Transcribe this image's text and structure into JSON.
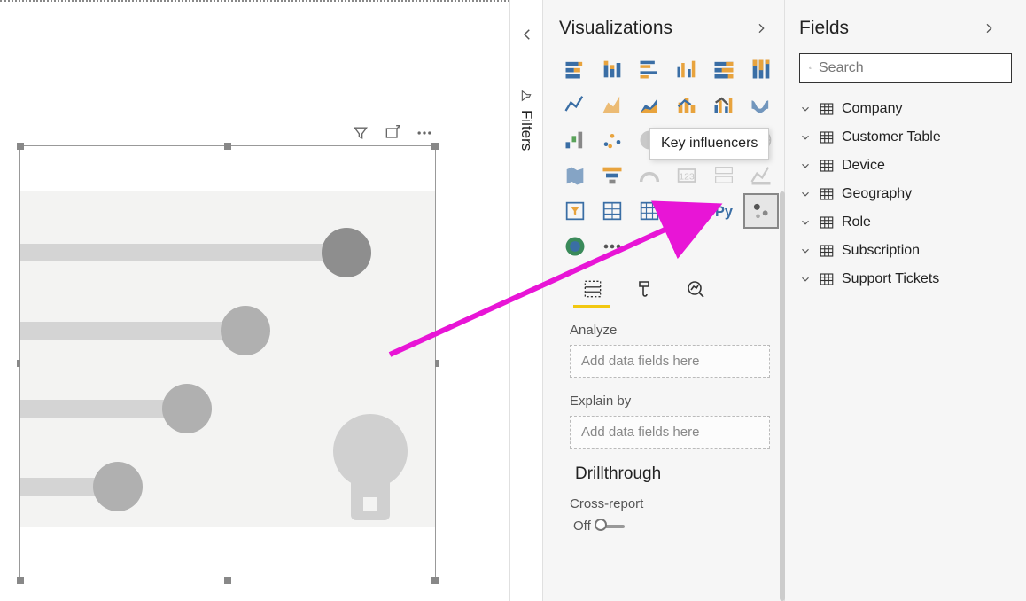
{
  "filters": {
    "label": "Filters"
  },
  "visualizations": {
    "title": "Visualizations",
    "tooltip": "Key influencers",
    "tabs": {
      "analyze_label": "Analyze",
      "analyze_placeholder": "Add data fields here",
      "explain_label": "Explain by",
      "explain_placeholder": "Add data fields here"
    },
    "drillthrough": {
      "title": "Drillthrough",
      "cross_report_label": "Cross-report",
      "cross_report_state": "Off"
    }
  },
  "fields": {
    "title": "Fields",
    "search_placeholder": "Search",
    "tables": [
      {
        "name": "Company"
      },
      {
        "name": "Customer Table"
      },
      {
        "name": "Device"
      },
      {
        "name": "Geography"
      },
      {
        "name": "Role"
      },
      {
        "name": "Subscription"
      },
      {
        "name": "Support Tickets"
      }
    ]
  }
}
